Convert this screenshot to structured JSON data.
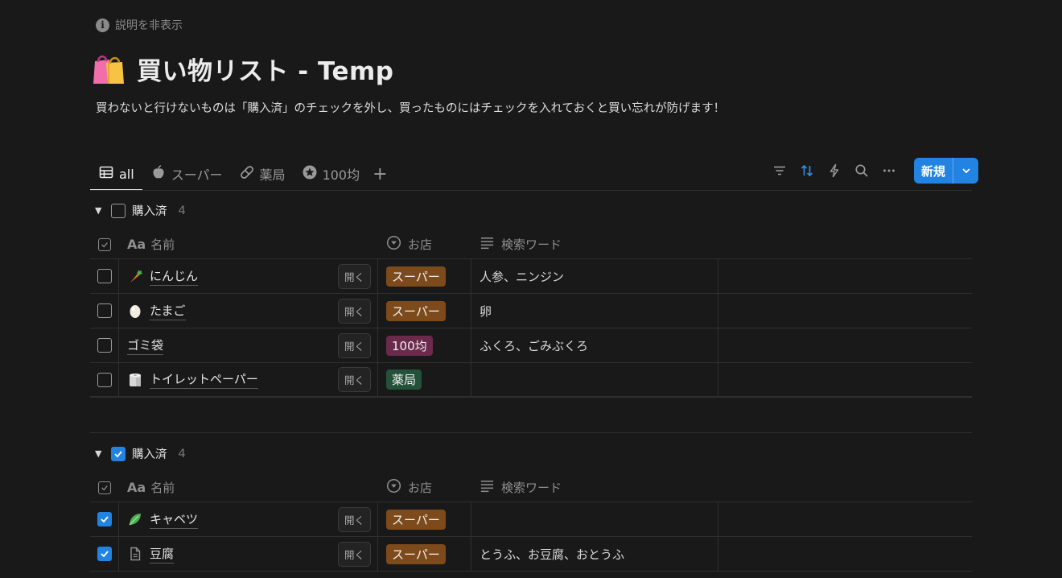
{
  "header": {
    "hide_description": "説明を非表示",
    "title": "買い物リスト - Temp",
    "description": "買わないと行けないものは「購入済」のチェックを外し、買ったものにはチェックを入れておくと買い忘れが防げます！"
  },
  "tabs": [
    {
      "label": "all",
      "icon": "table-icon",
      "active": true
    },
    {
      "label": "スーパー",
      "icon": "apple-icon",
      "active": false
    },
    {
      "label": "薬局",
      "icon": "pill-icon",
      "active": false
    },
    {
      "label": "100均",
      "icon": "star-icon",
      "active": false
    }
  ],
  "toolbar": {
    "new_label": "新規",
    "icons": [
      "filter-icon",
      "sort-icon",
      "automation-icon",
      "search-icon",
      "more-icon"
    ]
  },
  "columns": {
    "aa": "Aa",
    "name": "名前",
    "shop": "お店",
    "keywords": "検索ワード"
  },
  "open_label": "開く",
  "shop_colors": {
    "スーパー": "#7d4a1c",
    "100均": "#6b2a4c",
    "薬局": "#24513a"
  },
  "groups": [
    {
      "label": "購入済",
      "checked": false,
      "count": "4",
      "rows": [
        {
          "name": "にんじん",
          "icon": "carrot-icon",
          "shop": "スーパー",
          "keywords": "人参、ニンジン",
          "checked": false
        },
        {
          "name": "たまご",
          "icon": "egg-icon",
          "shop": "スーパー",
          "keywords": "卵",
          "checked": false
        },
        {
          "name": "ゴミ袋",
          "icon": "",
          "shop": "100均",
          "keywords": "ふくろ、ごみぶくろ",
          "checked": false
        },
        {
          "name": "トイレットペーパー",
          "icon": "toilet-paper-icon",
          "shop": "薬局",
          "keywords": "",
          "checked": false
        }
      ]
    },
    {
      "label": "購入済",
      "checked": true,
      "count": "4",
      "rows": [
        {
          "name": "キャベツ",
          "icon": "leafy-green-icon",
          "shop": "スーパー",
          "keywords": "",
          "checked": true
        },
        {
          "name": "豆腐",
          "icon": "page-icon",
          "shop": "スーパー",
          "keywords": "とうふ、お豆腐、おとうふ",
          "checked": true
        }
      ]
    }
  ]
}
